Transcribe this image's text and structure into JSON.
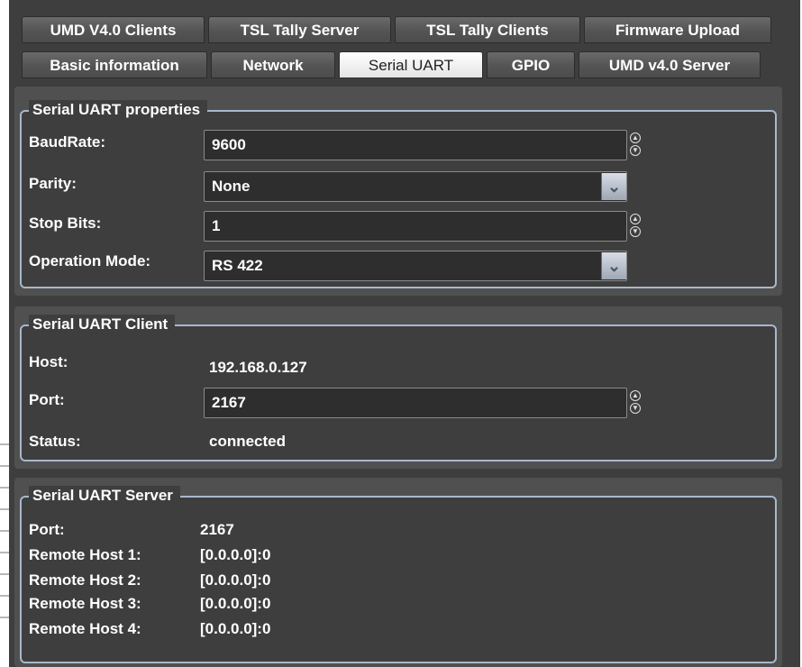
{
  "tabs_row1": [
    "UMD V4.0 Clients",
    "TSL Tally Server",
    "TSL Tally Clients",
    "Firmware Upload"
  ],
  "tabs_row2": [
    "Basic information",
    "Network",
    "Serial UART",
    "GPIO",
    "UMD v4.0 Server"
  ],
  "active_tab": "Serial UART",
  "properties": {
    "title": "Serial UART properties",
    "baud_label": "BaudRate:",
    "baud_value": "9600",
    "parity_label": "Parity:",
    "parity_value": "None",
    "stop_label": "Stop Bits:",
    "stop_value": "1",
    "mode_label": "Operation Mode:",
    "mode_value": "RS 422"
  },
  "client": {
    "title": "Serial UART Client",
    "host_label": "Host:",
    "host_value": "192.168.0.127",
    "port_label": "Port:",
    "port_value": "2167",
    "status_label": "Status:",
    "status_value": "connected"
  },
  "server": {
    "title": "Serial UART Server",
    "port_label": "Port:",
    "port_value": "2167",
    "remotes": [
      {
        "label": "Remote Host 1:",
        "value": "[0.0.0.0]:0"
      },
      {
        "label": "Remote Host 2:",
        "value": "[0.0.0.0]:0"
      },
      {
        "label": "Remote Host 3:",
        "value": "[0.0.0.0]:0"
      },
      {
        "label": "Remote Host 4:",
        "value": "[0.0.0.0]:0"
      }
    ]
  },
  "icons": {
    "spinner": "up-down-spinner-icon",
    "dropdown": "chevron-down-icon"
  },
  "colors": {
    "panel": "#3e3e3e",
    "group_border": "#a8b8cc",
    "active_tab": "#ffffff"
  }
}
